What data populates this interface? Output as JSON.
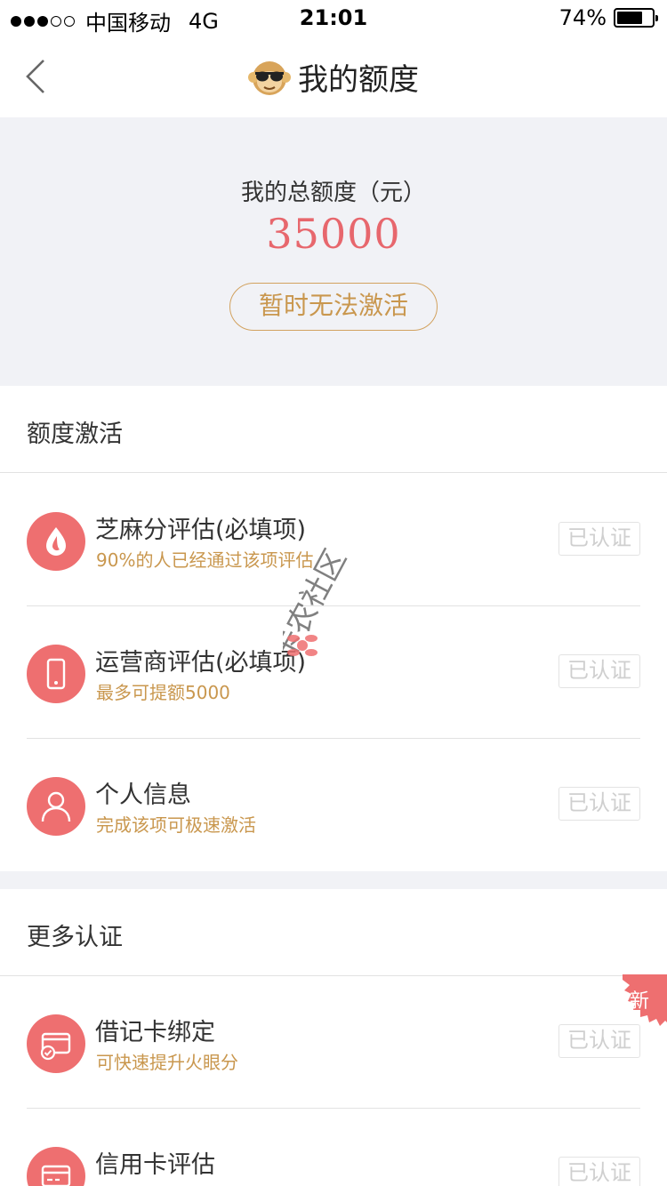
{
  "status_bar": {
    "carrier": "中国移动",
    "network": "4G",
    "time": "21:01",
    "battery_percent": "74%",
    "battery_level": 0.74,
    "signal_filled": 3,
    "signal_total": 5
  },
  "nav": {
    "title": "我的额度",
    "back_icon": "chevron-left-icon",
    "title_icon": "monkey-sunglasses-icon"
  },
  "summary": {
    "label": "我的总额度（元）",
    "amount": "35000",
    "activate_button": "暂时无法激活"
  },
  "sections": {
    "activation": {
      "header": "额度激活",
      "items": [
        {
          "title": "芝麻分评估(必填项)",
          "subtitle": "90%的人已经通过该项评估",
          "status": "已认证",
          "icon": "sesame-drop-icon"
        },
        {
          "title": "运营商评估(必填项)",
          "subtitle": "最多可提额5000",
          "status": "已认证",
          "icon": "phone-icon"
        },
        {
          "title": "个人信息",
          "subtitle": "完成该项可极速激活",
          "status": "已认证",
          "icon": "person-icon"
        }
      ]
    },
    "more": {
      "header": "更多认证",
      "new_badge": "新",
      "items": [
        {
          "title": "借记卡绑定",
          "subtitle": "可快速提升火眼分",
          "status": "已认证",
          "icon": "debit-card-icon"
        },
        {
          "title": "信用卡评估",
          "subtitle": "",
          "status": "已认证",
          "icon": "credit-card-icon"
        }
      ]
    }
  },
  "watermark": {
    "text": "卡农社区"
  },
  "colors": {
    "accent_red": "#ee6f70",
    "amount_red": "#e7676d",
    "gold": "#c9974e",
    "background_gray": "#f1f2f6"
  }
}
